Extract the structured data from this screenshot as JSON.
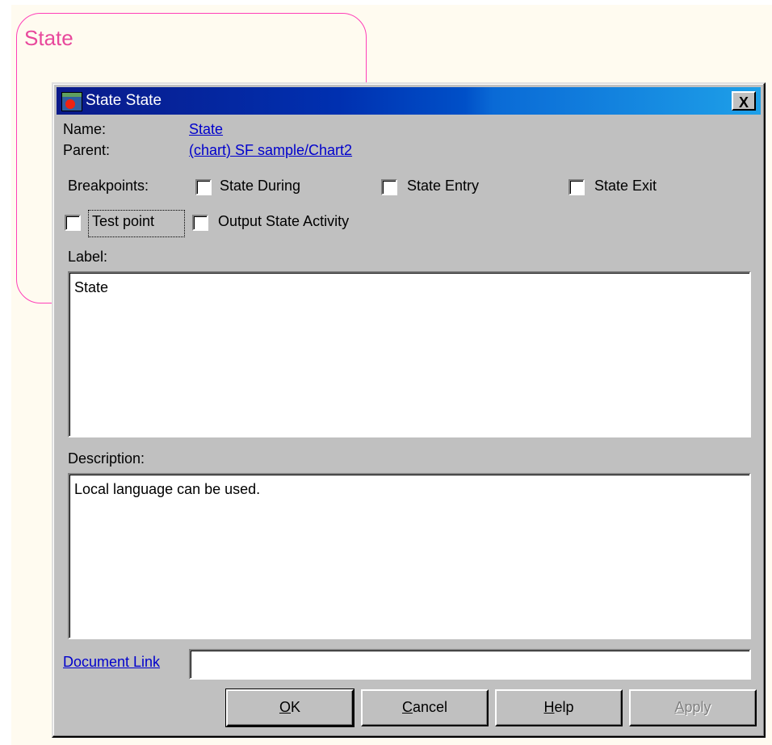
{
  "canvas": {
    "state_title": "State"
  },
  "dialog": {
    "title": "State State",
    "close_label": "X",
    "name_label": "Name:",
    "name_value": "State",
    "parent_label": "Parent:",
    "parent_value": "(chart) SF sample/Chart2",
    "breakpoints_label": "Breakpoints:",
    "breakpoints": [
      {
        "label": "State During",
        "checked": false
      },
      {
        "label": "State Entry",
        "checked": false
      },
      {
        "label": "State Exit",
        "checked": false
      }
    ],
    "test_point_label": "Test point",
    "test_point_checked": false,
    "output_state_label": "Output State Activity",
    "output_state_checked": false,
    "label_label": "Label:",
    "label_value": "State",
    "description_label": "Description:",
    "description_value": "Local language can be used.",
    "document_link_label": "Document Link",
    "document_link_value": "",
    "buttons": {
      "ok": {
        "label": "OK",
        "mnemonic": "O",
        "rest": "K"
      },
      "cancel": {
        "label": "Cancel",
        "mnemonic": "C",
        "rest": "ancel"
      },
      "help": {
        "label": "Help",
        "mnemonic": "H",
        "rest": "elp"
      },
      "apply": {
        "label": "Apply",
        "mnemonic": "A",
        "rest": "pply",
        "disabled": true
      }
    }
  }
}
